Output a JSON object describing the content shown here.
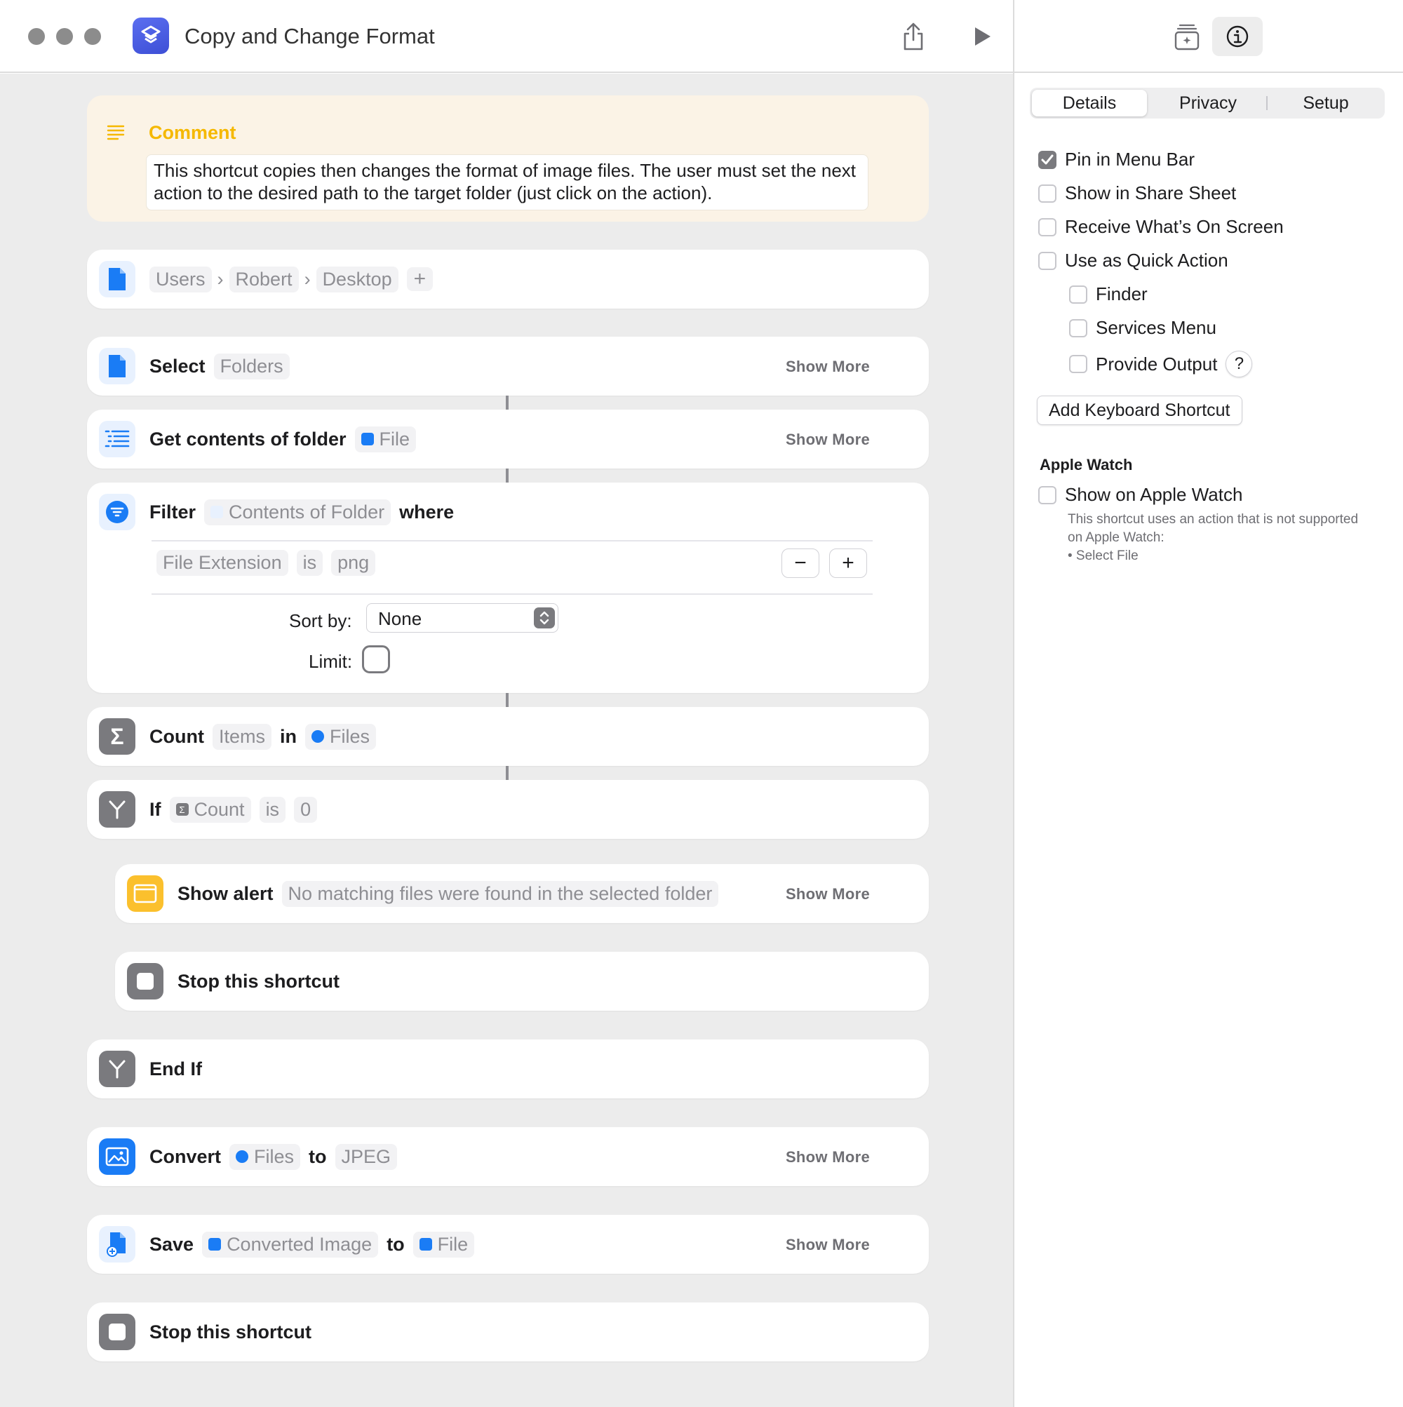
{
  "window": {
    "title": "Copy and Change Format"
  },
  "colors": {
    "accent_blue": "#1a7cf5",
    "comment_yellow": "#f5b800",
    "scripting_gray": "#8e8e93",
    "alert_yellow": "#fbc02d"
  },
  "comment": {
    "title": "Comment",
    "text": "This shortcut copies then changes the format of image files. The user must set the next action to the desired path to the target folder (just click on the action)."
  },
  "actions": {
    "file_path": {
      "seg1": "Users",
      "seg2": "Robert",
      "seg3": "Desktop",
      "add": "+"
    },
    "select": {
      "label": "Select",
      "param": "Folders",
      "more": "Show More"
    },
    "get_contents": {
      "label": "Get contents of folder",
      "param": "File",
      "more": "Show More"
    },
    "filter": {
      "label": "Filter",
      "param": "Contents of Folder",
      "where": "where",
      "cond_field": "File Extension",
      "cond_op": "is",
      "cond_value": "png",
      "minus": "−",
      "plus": "+",
      "sort_label": "Sort by:",
      "sort_value": "None",
      "limit_label": "Limit:"
    },
    "count": {
      "label": "Count",
      "param": "Items",
      "in": "in",
      "param2": "Files"
    },
    "if": {
      "label": "If",
      "param": "Count",
      "op": "is",
      "value": "0"
    },
    "show_alert": {
      "label": "Show alert",
      "param": "No matching files were found in the selected folder",
      "more": "Show More"
    },
    "stop1": {
      "label": "Stop this shortcut"
    },
    "end_if": {
      "label": "End If"
    },
    "convert": {
      "label": "Convert",
      "param": "Files",
      "to": "to",
      "param2": "JPEG",
      "more": "Show More"
    },
    "save": {
      "label": "Save",
      "param": "Converted Image",
      "to": "to",
      "param2": "File",
      "more": "Show More"
    },
    "stop2": {
      "label": "Stop this shortcut"
    }
  },
  "sidebar": {
    "tabs": [
      "Details",
      "Privacy",
      "Setup"
    ],
    "options": {
      "pin_menu_bar": "Pin in Menu Bar",
      "share_sheet": "Show in Share Sheet",
      "receive_screen": "Receive What’s On Screen",
      "quick_action": "Use as Quick Action",
      "finder": "Finder",
      "services": "Services Menu",
      "provide_output": "Provide Output",
      "help": "?"
    },
    "keyboard_button": "Add Keyboard Shortcut",
    "apple_watch": {
      "heading": "Apple Watch",
      "option": "Show on Apple Watch",
      "note": "This shortcut uses an action that is not supported on Apple Watch:",
      "bullet": "• Select File"
    }
  }
}
